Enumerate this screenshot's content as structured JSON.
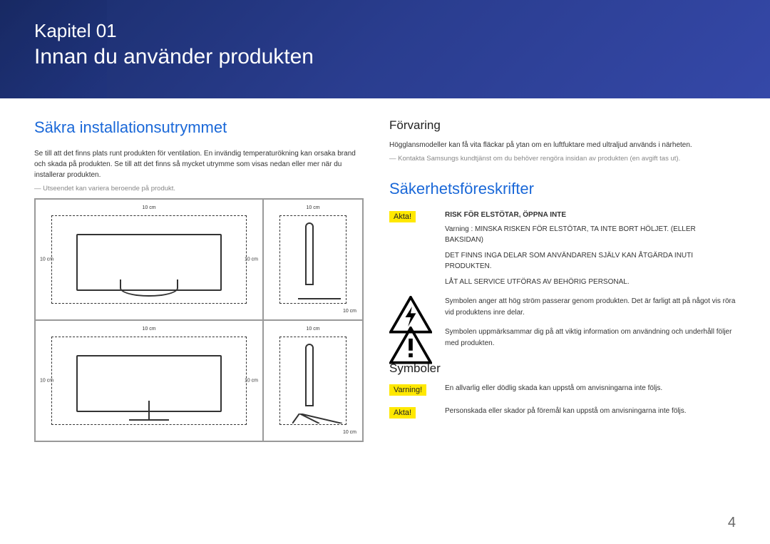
{
  "header": {
    "chapter_label": "Kapitel 01",
    "chapter_title": "Innan du använder produkten"
  },
  "left": {
    "heading": "Säkra installationsutrymmet",
    "body": "Se till att det finns plats runt produkten för ventilation. En invändig temperaturökning kan orsaka brand och skada på produkten. Se till att det finns så mycket utrymme som visas nedan eller mer när du installerar produkten.",
    "note": "Utseendet kan variera beroende på produkt.",
    "dim": "10 cm"
  },
  "right": {
    "storage_heading": "Förvaring",
    "storage_body": "Högglansmodeller kan få vita fläckar på ytan om en luftfuktare med ultraljud används i närheten.",
    "storage_note": "Kontakta Samsungs kundtjänst om du behöver rengöra insidan av produkten (en avgift tas ut).",
    "safety_heading": "Säkerhetsföreskrifter",
    "caution_label": "Akta!",
    "caution_title": "RISK FÖR ELSTÖTAR, ÖPPNA INTE",
    "caution_p1": "Varning : MINSKA RISKEN FÖR ELSTÖTAR, TA INTE BORT HÖLJET. (ELLER BAKSIDAN)",
    "caution_p2": "DET FINNS INGA DELAR SOM ANVÄNDAREN SJÄLV KAN ÅTGÄRDA INUTI PRODUKTEN.",
    "caution_p3": "LÅT ALL SERVICE UTFÖRAS AV BEHÖRIG PERSONAL.",
    "bolt_text": "Symbolen anger att hög ström passerar genom produkten. Det är farligt att på något vis röra vid produktens inre delar.",
    "excl_text": "Symbolen uppmärksammar dig på att viktig information om användning och underhåll följer med produkten.",
    "symbols_heading": "Symboler",
    "warning_label": "Varning!",
    "warning_text": "En allvarlig eller dödlig skada kan uppstå om anvisningarna inte följs.",
    "caution2_label": "Akta!",
    "caution2_text": "Personskada eller skador på föremål kan uppstå om anvisningarna inte följs."
  },
  "page_number": "4"
}
